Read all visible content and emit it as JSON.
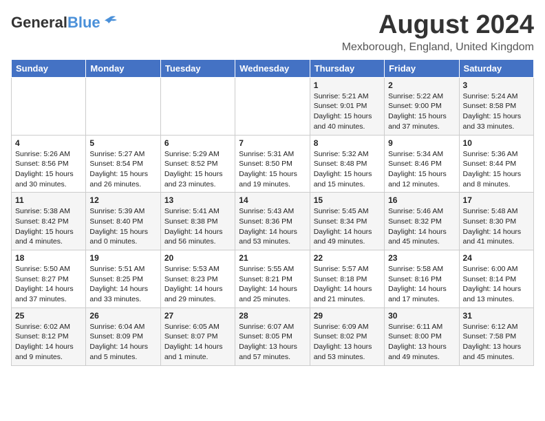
{
  "header": {
    "logo_general": "General",
    "logo_blue": "Blue",
    "month_title": "August 2024",
    "location": "Mexborough, England, United Kingdom"
  },
  "days_of_week": [
    "Sunday",
    "Monday",
    "Tuesday",
    "Wednesday",
    "Thursday",
    "Friday",
    "Saturday"
  ],
  "weeks": [
    [
      {
        "day": "",
        "info": ""
      },
      {
        "day": "",
        "info": ""
      },
      {
        "day": "",
        "info": ""
      },
      {
        "day": "",
        "info": ""
      },
      {
        "day": "1",
        "info": "Sunrise: 5:21 AM\nSunset: 9:01 PM\nDaylight: 15 hours\nand 40 minutes."
      },
      {
        "day": "2",
        "info": "Sunrise: 5:22 AM\nSunset: 9:00 PM\nDaylight: 15 hours\nand 37 minutes."
      },
      {
        "day": "3",
        "info": "Sunrise: 5:24 AM\nSunset: 8:58 PM\nDaylight: 15 hours\nand 33 minutes."
      }
    ],
    [
      {
        "day": "4",
        "info": "Sunrise: 5:26 AM\nSunset: 8:56 PM\nDaylight: 15 hours\nand 30 minutes."
      },
      {
        "day": "5",
        "info": "Sunrise: 5:27 AM\nSunset: 8:54 PM\nDaylight: 15 hours\nand 26 minutes."
      },
      {
        "day": "6",
        "info": "Sunrise: 5:29 AM\nSunset: 8:52 PM\nDaylight: 15 hours\nand 23 minutes."
      },
      {
        "day": "7",
        "info": "Sunrise: 5:31 AM\nSunset: 8:50 PM\nDaylight: 15 hours\nand 19 minutes."
      },
      {
        "day": "8",
        "info": "Sunrise: 5:32 AM\nSunset: 8:48 PM\nDaylight: 15 hours\nand 15 minutes."
      },
      {
        "day": "9",
        "info": "Sunrise: 5:34 AM\nSunset: 8:46 PM\nDaylight: 15 hours\nand 12 minutes."
      },
      {
        "day": "10",
        "info": "Sunrise: 5:36 AM\nSunset: 8:44 PM\nDaylight: 15 hours\nand 8 minutes."
      }
    ],
    [
      {
        "day": "11",
        "info": "Sunrise: 5:38 AM\nSunset: 8:42 PM\nDaylight: 15 hours\nand 4 minutes."
      },
      {
        "day": "12",
        "info": "Sunrise: 5:39 AM\nSunset: 8:40 PM\nDaylight: 15 hours\nand 0 minutes."
      },
      {
        "day": "13",
        "info": "Sunrise: 5:41 AM\nSunset: 8:38 PM\nDaylight: 14 hours\nand 56 minutes."
      },
      {
        "day": "14",
        "info": "Sunrise: 5:43 AM\nSunset: 8:36 PM\nDaylight: 14 hours\nand 53 minutes."
      },
      {
        "day": "15",
        "info": "Sunrise: 5:45 AM\nSunset: 8:34 PM\nDaylight: 14 hours\nand 49 minutes."
      },
      {
        "day": "16",
        "info": "Sunrise: 5:46 AM\nSunset: 8:32 PM\nDaylight: 14 hours\nand 45 minutes."
      },
      {
        "day": "17",
        "info": "Sunrise: 5:48 AM\nSunset: 8:30 PM\nDaylight: 14 hours\nand 41 minutes."
      }
    ],
    [
      {
        "day": "18",
        "info": "Sunrise: 5:50 AM\nSunset: 8:27 PM\nDaylight: 14 hours\nand 37 minutes."
      },
      {
        "day": "19",
        "info": "Sunrise: 5:51 AM\nSunset: 8:25 PM\nDaylight: 14 hours\nand 33 minutes."
      },
      {
        "day": "20",
        "info": "Sunrise: 5:53 AM\nSunset: 8:23 PM\nDaylight: 14 hours\nand 29 minutes."
      },
      {
        "day": "21",
        "info": "Sunrise: 5:55 AM\nSunset: 8:21 PM\nDaylight: 14 hours\nand 25 minutes."
      },
      {
        "day": "22",
        "info": "Sunrise: 5:57 AM\nSunset: 8:18 PM\nDaylight: 14 hours\nand 21 minutes."
      },
      {
        "day": "23",
        "info": "Sunrise: 5:58 AM\nSunset: 8:16 PM\nDaylight: 14 hours\nand 17 minutes."
      },
      {
        "day": "24",
        "info": "Sunrise: 6:00 AM\nSunset: 8:14 PM\nDaylight: 14 hours\nand 13 minutes."
      }
    ],
    [
      {
        "day": "25",
        "info": "Sunrise: 6:02 AM\nSunset: 8:12 PM\nDaylight: 14 hours\nand 9 minutes."
      },
      {
        "day": "26",
        "info": "Sunrise: 6:04 AM\nSunset: 8:09 PM\nDaylight: 14 hours\nand 5 minutes."
      },
      {
        "day": "27",
        "info": "Sunrise: 6:05 AM\nSunset: 8:07 PM\nDaylight: 14 hours\nand 1 minute."
      },
      {
        "day": "28",
        "info": "Sunrise: 6:07 AM\nSunset: 8:05 PM\nDaylight: 13 hours\nand 57 minutes."
      },
      {
        "day": "29",
        "info": "Sunrise: 6:09 AM\nSunset: 8:02 PM\nDaylight: 13 hours\nand 53 minutes."
      },
      {
        "day": "30",
        "info": "Sunrise: 6:11 AM\nSunset: 8:00 PM\nDaylight: 13 hours\nand 49 minutes."
      },
      {
        "day": "31",
        "info": "Sunrise: 6:12 AM\nSunset: 7:58 PM\nDaylight: 13 hours\nand 45 minutes."
      }
    ]
  ]
}
